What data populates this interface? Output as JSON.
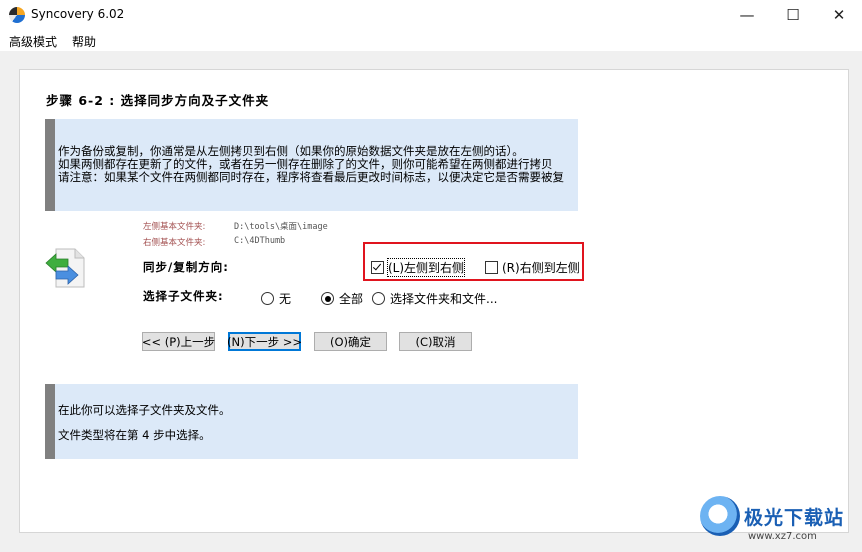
{
  "window": {
    "title": "Syncovery 6.02",
    "controls": {
      "minimize": "—",
      "maximize": "☐",
      "close": "✕"
    }
  },
  "menu": {
    "items": [
      "高级模式",
      "帮助"
    ]
  },
  "step": {
    "title": "步骤 6-2 : 选择同步方向及子文件夹"
  },
  "info_top": {
    "lines": [
      "作为备份或复制，你通常是从左侧拷贝到右侧（如果你的原始数据文件夹是放在左侧的话）。",
      " 如果两侧都存在更新了的文件，或者在另一侧存在删除了的文件，则你可能希望在两侧都进行拷贝",
      "请注意：如果某个文件在两侧都同时存在，程序将查看最后更改时间标志，以便决定它是否需要被复"
    ]
  },
  "paths": {
    "left_label": "左侧基本文件夹:",
    "left_value": "D:\\tools\\桌面\\image",
    "right_label": "右侧基本文件夹:",
    "right_value": "C:\\4DThumb"
  },
  "direction": {
    "label": "同步/复制方向:",
    "left_to_right": {
      "label": "(L)左侧到右侧",
      "checked": true
    },
    "right_to_left": {
      "label": "(R)右侧到左侧",
      "checked": false
    }
  },
  "subfolders": {
    "label": "选择子文件夹:",
    "options": [
      {
        "label": "无",
        "selected": false
      },
      {
        "label": "全部",
        "selected": true
      },
      {
        "label": "选择文件夹和文件...",
        "selected": false
      }
    ]
  },
  "buttons": {
    "prev": "<< (P)上一步",
    "next": "(N)下一步 >>",
    "ok": "(O)确定",
    "cancel": "(C)取消"
  },
  "info_bottom": {
    "lines": [
      "在此你可以选择子文件夹及文件。",
      "文件类型将在第 4 步中选择。"
    ]
  },
  "watermark": {
    "text": "极光下载站",
    "url": "www.xz7.com"
  },
  "colors": {
    "info_bg": "#dce9f8",
    "info_bar": "#808080",
    "highlight_box": "#e0141e",
    "default_button": "#0078d7"
  }
}
